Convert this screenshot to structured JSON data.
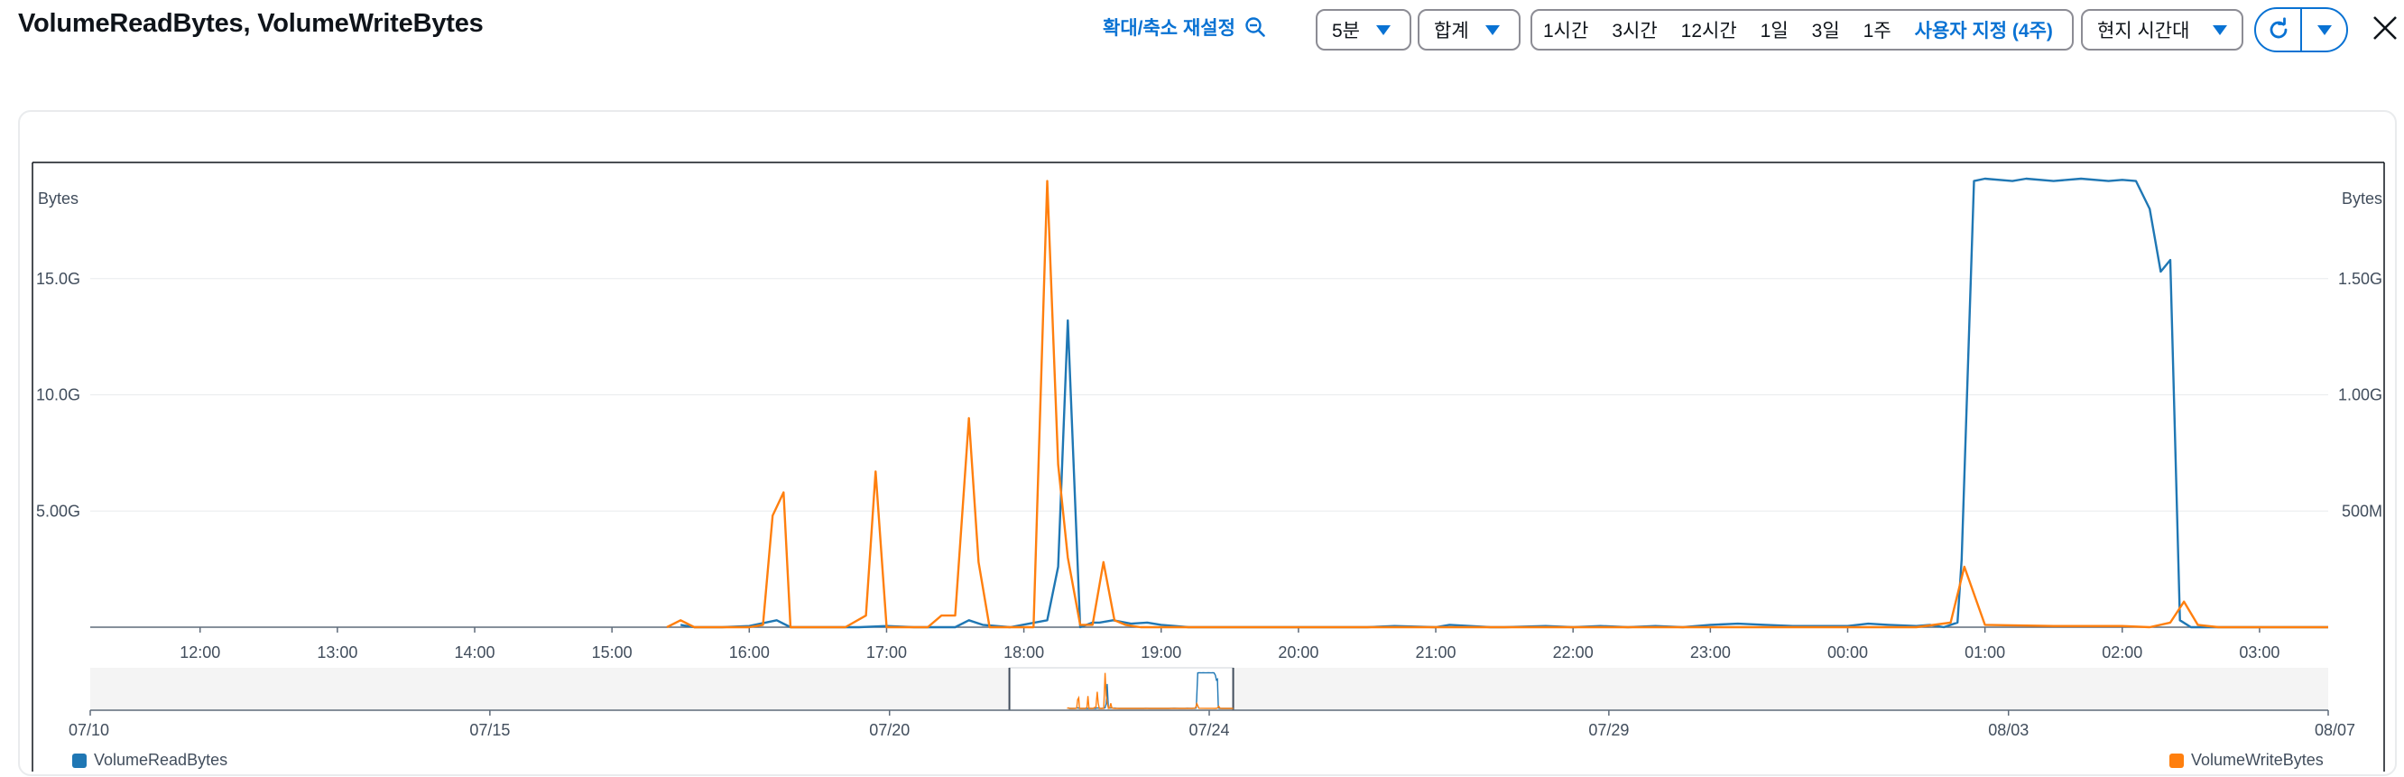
{
  "header": {
    "title": "VolumeReadBytes, VolumeWriteBytes",
    "zoom_reset": "확대/축소 재설정",
    "period": "5분",
    "statistic": "합계",
    "ranges": [
      "1시간",
      "3시간",
      "12시간",
      "1일",
      "3일",
      "1주"
    ],
    "custom_range": "사용자 지정 (4주)",
    "timezone": "현지 시간대"
  },
  "colors": {
    "read": "#1f77b4",
    "write": "#ff7f0e",
    "accent": "#0972d3"
  },
  "chart_data": {
    "type": "line",
    "left_axis": {
      "label": "Bytes",
      "ticks": [
        "5.00G",
        "10.0G",
        "15.0G"
      ],
      "tick_values": [
        5,
        10,
        15
      ],
      "range": [
        0,
        20
      ],
      "unit": "G"
    },
    "right_axis": {
      "label": "Bytes",
      "ticks": [
        "500M",
        "1.00G",
        "1.50G"
      ],
      "tick_values": [
        500,
        1000,
        1500
      ],
      "range": [
        0,
        2000
      ],
      "unit": "M"
    },
    "x_ticks": [
      "12:00",
      "13:00",
      "14:00",
      "15:00",
      "16:00",
      "17:00",
      "18:00",
      "19:00",
      "20:00",
      "21:00",
      "22:00",
      "23:00",
      "00:00",
      "01:00",
      "02:00",
      "03:00"
    ],
    "x_tick_hours": [
      12,
      13,
      14,
      15,
      16,
      17,
      18,
      19,
      20,
      21,
      22,
      23,
      24,
      25,
      26,
      27
    ],
    "x_range_hours": [
      11.2,
      27.5
    ],
    "series": [
      {
        "name": "VolumeReadBytes",
        "axis": "left",
        "hours": [
          15.5,
          15.6,
          15.8,
          16.0,
          16.2,
          16.3,
          16.5,
          16.8,
          17.0,
          17.2,
          17.5,
          17.6,
          17.7,
          17.9,
          18.17,
          18.25,
          18.32,
          18.41,
          18.5,
          18.55,
          18.65,
          18.78,
          18.9,
          19.0,
          19.2,
          19.5,
          20.0,
          20.5,
          20.7,
          21.0,
          21.1,
          21.4,
          21.5,
          21.8,
          22.0,
          22.2,
          22.4,
          22.6,
          22.8,
          23.0,
          23.2,
          23.4,
          23.6,
          24.0,
          24.15,
          24.3,
          24.5,
          24.6,
          24.7,
          24.8,
          24.83,
          24.92,
          25.0,
          25.2,
          25.3,
          25.5,
          25.7,
          25.9,
          26.0,
          26.1,
          26.2,
          26.28,
          26.35,
          26.42,
          26.5,
          26.6,
          27.0,
          27.5
        ],
        "values": [
          0.1,
          0.0,
          0.0,
          0.05,
          0.3,
          0.0,
          0.0,
          0.0,
          0.05,
          0.0,
          0.0,
          0.3,
          0.1,
          0.0,
          0.3,
          2.6,
          13.2,
          0.0,
          0.2,
          0.2,
          0.3,
          0.15,
          0.2,
          0.1,
          0.0,
          0.0,
          0.0,
          0.0,
          0.05,
          0.0,
          0.1,
          0.0,
          0.0,
          0.05,
          0.0,
          0.05,
          0.0,
          0.05,
          0.0,
          0.1,
          0.15,
          0.1,
          0.05,
          0.05,
          0.15,
          0.1,
          0.05,
          0.1,
          0.0,
          0.2,
          2.9,
          19.2,
          19.3,
          19.2,
          19.3,
          19.2,
          19.3,
          19.2,
          19.25,
          19.2,
          18.0,
          15.3,
          15.8,
          0.3,
          0.0,
          0.0,
          0.0,
          0.0
        ]
      },
      {
        "name": "VolumeWriteBytes",
        "axis": "left",
        "hours": [
          15.4,
          15.5,
          15.6,
          15.8,
          16.0,
          16.1,
          16.17,
          16.25,
          16.3,
          16.5,
          16.7,
          16.85,
          16.92,
          17.0,
          17.1,
          17.3,
          17.4,
          17.5,
          17.6,
          17.67,
          17.75,
          17.85,
          18.0,
          18.07,
          18.17,
          18.25,
          18.32,
          18.41,
          18.5,
          18.58,
          18.66,
          18.74,
          18.85,
          19.0,
          19.2,
          20.0,
          21.0,
          22.0,
          23.0,
          24.0,
          24.5,
          24.75,
          24.85,
          25.0,
          25.5,
          26.0,
          26.2,
          26.35,
          26.45,
          26.55,
          26.7,
          27.0,
          27.5
        ],
        "values": [
          0.0,
          0.3,
          0.0,
          0.0,
          0.0,
          0.1,
          4.8,
          5.8,
          0.0,
          0.0,
          0.0,
          0.5,
          6.7,
          0.0,
          0.0,
          0.0,
          0.5,
          0.5,
          9.0,
          2.8,
          0.0,
          0.0,
          0.0,
          0.0,
          19.2,
          7.0,
          3.0,
          0.1,
          0.1,
          2.8,
          0.3,
          0.1,
          0.0,
          0.0,
          0.0,
          0.0,
          0.0,
          0.0,
          0.0,
          0.0,
          0.0,
          0.2,
          2.6,
          0.1,
          0.05,
          0.05,
          0.0,
          0.2,
          1.1,
          0.1,
          0.0,
          0.0,
          0.0
        ]
      }
    ],
    "navigator": {
      "x_ticks": [
        "07/10",
        "07/15",
        "07/20",
        "07/24",
        "07/29",
        "08/03",
        "08/07"
      ],
      "x_tick_days": [
        0,
        5,
        10,
        14,
        19,
        24,
        28
      ],
      "selected_days": [
        11.5,
        14.3
      ]
    }
  },
  "legend": {
    "read": "VolumeReadBytes",
    "write": "VolumeWriteBytes"
  }
}
